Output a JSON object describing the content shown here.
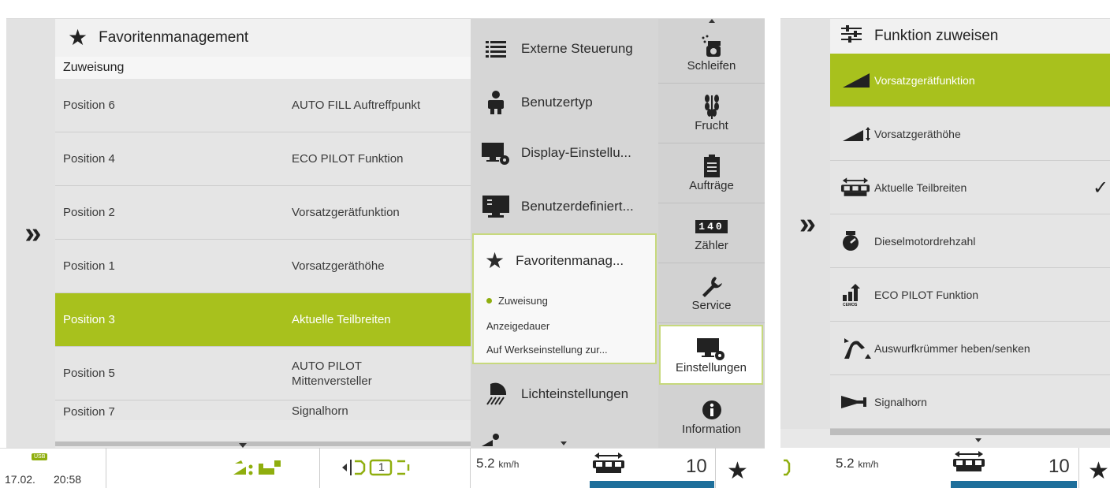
{
  "left": {
    "collapse_glyph": "»",
    "header_title": "Favoritenmanagement",
    "section_label": "Zuweisung",
    "rows": [
      {
        "pos": "Position 6",
        "func": "AUTO FILL Auftreffpunkt"
      },
      {
        "pos": "Position 4",
        "func": "ECO PILOT Funktion"
      },
      {
        "pos": "Position 2",
        "func": "Vorsatzgerätfunktion"
      },
      {
        "pos": "Position 1",
        "func": "Vorsatzgeräthöhe"
      },
      {
        "pos": "Position 3",
        "func": "Aktuelle Teilbreiten"
      },
      {
        "pos": "Position 5",
        "func": "AUTO PILOT Mittenversteller"
      },
      {
        "pos": "Position 7",
        "func": "Signalhorn"
      }
    ],
    "menu": [
      {
        "label": "Externe Steuerung",
        "icon": "list-icon"
      },
      {
        "label": "Benutzertyp",
        "icon": "user-icon"
      },
      {
        "label": "Display-Einstellu...",
        "icon": "display-settings-icon"
      },
      {
        "label": "Benutzerdefiniert...",
        "icon": "monitor-icon"
      },
      {
        "label": "Favoritenmanag...",
        "icon": "star-icon"
      },
      {
        "label": "Lichteinstellungen",
        "icon": "light-icon"
      }
    ],
    "submenu": [
      "Zuweisung",
      "Anzeigedauer",
      "Auf Werkseinstellung zur..."
    ],
    "tabs": [
      {
        "label": "Schleifen",
        "icon": "grinding-icon"
      },
      {
        "label": "Frucht",
        "icon": "crop-icon"
      },
      {
        "label": "Aufträge",
        "icon": "clipboard-icon"
      },
      {
        "label": "Zähler",
        "icon": "counter-icon"
      },
      {
        "label": "Service",
        "icon": "wrench-icon"
      },
      {
        "label": "Einstellungen",
        "icon": "settings-display-icon"
      },
      {
        "label": "Information",
        "icon": "info-icon"
      }
    ],
    "counter_digits": "140",
    "status": {
      "usb": "USB",
      "date": "17.02.",
      "time": "20:58",
      "gear": "1",
      "speed": "5.2",
      "speed_unit": "km/h",
      "count": "10",
      "favorite_glyph": "★"
    }
  },
  "right": {
    "collapse_glyph": "»",
    "header_title": "Funktion zuweisen",
    "items": [
      {
        "label": "Vorsatzgerätfunktion",
        "icon": "header-function-icon"
      },
      {
        "label": "Vorsatzgeräthöhe",
        "icon": "header-height-icon"
      },
      {
        "label": "Aktuelle Teilbreiten",
        "icon": "partial-widths-icon"
      },
      {
        "label": "Dieselmotordrehzahl",
        "icon": "engine-speed-icon"
      },
      {
        "label": "ECO PILOT Funktion",
        "icon": "cemos-icon"
      },
      {
        "label": "Auswurfkrümmer heben/senken",
        "icon": "spout-icon"
      },
      {
        "label": "Signalhorn",
        "icon": "horn-icon"
      }
    ],
    "check_glyph": "✓",
    "cemos_label": "CEMOS",
    "status": {
      "speed": "5.2",
      "speed_unit": "km/h",
      "count": "10",
      "favorite_glyph": "★"
    }
  },
  "colors": {
    "accent_green": "#a8c11d",
    "status_blue": "#1e6f9b"
  }
}
